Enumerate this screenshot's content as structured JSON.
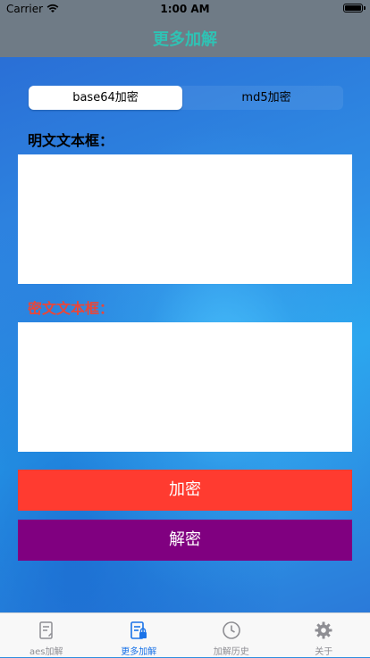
{
  "status_bar": {
    "carrier": "Carrier",
    "time": "1:00 AM"
  },
  "nav": {
    "title": "更多加解"
  },
  "segment": {
    "items": [
      {
        "label": "base64加密",
        "selected": true
      },
      {
        "label": "md5加密",
        "selected": false
      }
    ]
  },
  "plaintext": {
    "label": "明文文本框：",
    "value": ""
  },
  "ciphertext": {
    "label": "密文文本框：",
    "value": ""
  },
  "buttons": {
    "encrypt": "加密",
    "decrypt": "解密"
  },
  "colors": {
    "nav_title": "#2fc2b4",
    "cipher_label": "#e8473a",
    "encrypt_button": "#ff3b30",
    "decrypt_button": "#800080",
    "tab_active": "#1a73e8"
  },
  "tabbar": {
    "items": [
      {
        "label": "aes加解",
        "icon": "document-pen-icon",
        "active": false
      },
      {
        "label": "更多加解",
        "icon": "document-lock-icon",
        "active": true
      },
      {
        "label": "加解历史",
        "icon": "clock-icon",
        "active": false
      },
      {
        "label": "关于",
        "icon": "gear-icon",
        "active": false
      }
    ]
  }
}
